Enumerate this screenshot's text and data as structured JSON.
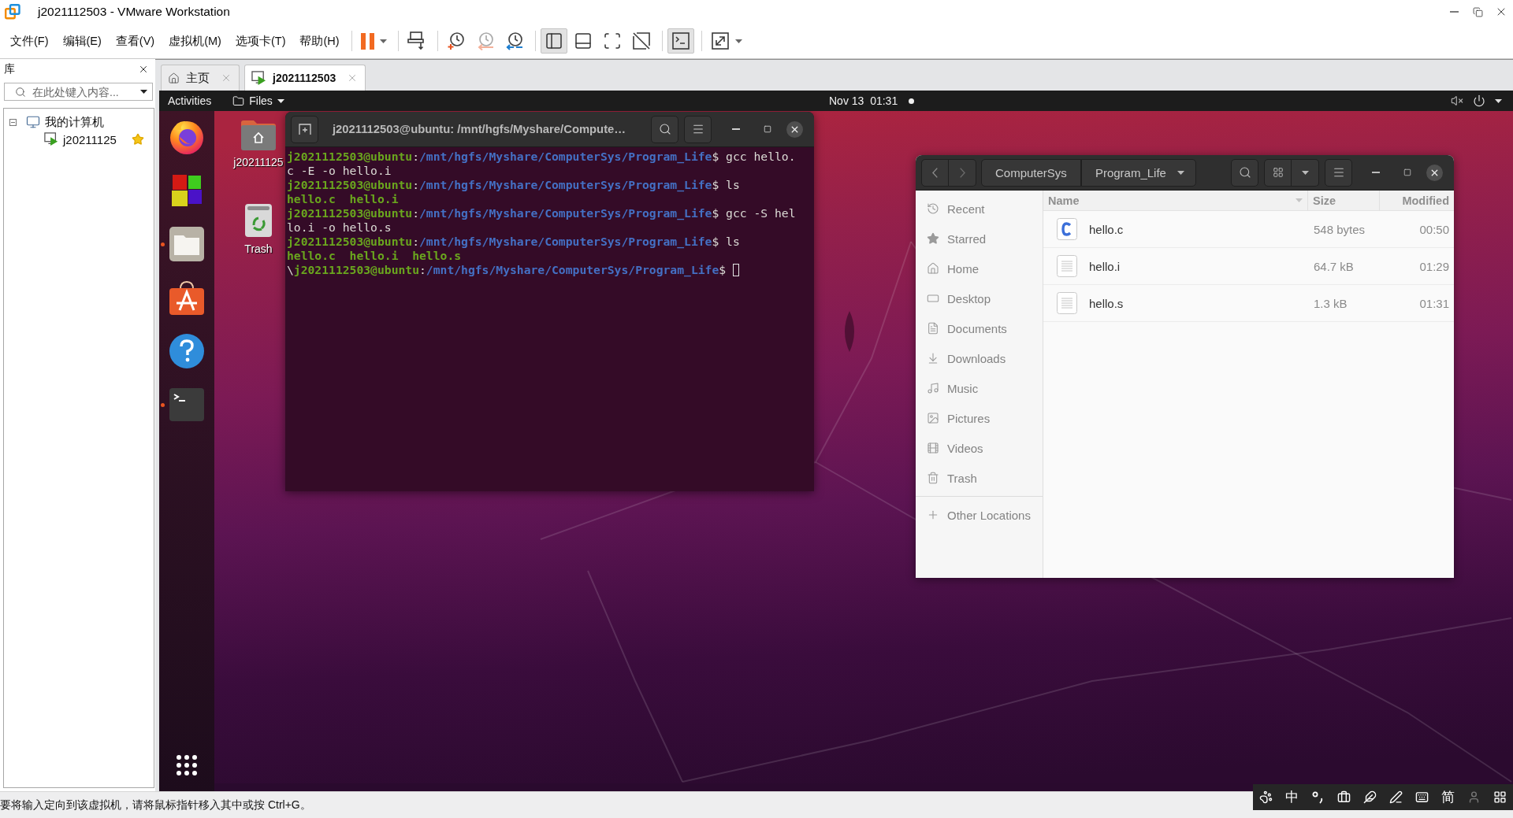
{
  "window": {
    "title": "j2021112503 - VMware Workstation"
  },
  "menu": [
    "文件(F)",
    "编辑(E)",
    "查看(V)",
    "虚拟机(M)",
    "选项卡(T)",
    "帮助(H)"
  ],
  "toolbar": [
    [
      {
        "kind": "pause",
        "dropdown": true,
        "selected": false,
        "disabled": false
      }
    ],
    [
      {
        "kind": "send_keys",
        "dropdown": false,
        "selected": false,
        "disabled": false
      }
    ],
    [
      {
        "kind": "snapshot",
        "dropdown": false,
        "selected": false,
        "disabled": false
      },
      {
        "kind": "revert",
        "dropdown": false,
        "selected": false,
        "disabled": true
      },
      {
        "kind": "snapshot_manager",
        "dropdown": false,
        "selected": false,
        "disabled": false
      }
    ],
    [
      {
        "kind": "library_view",
        "dropdown": false,
        "selected": true,
        "disabled": false
      },
      {
        "kind": "thumbnail_bar",
        "dropdown": false,
        "selected": false,
        "disabled": false
      },
      {
        "kind": "full_screen",
        "dropdown": false,
        "selected": false,
        "disabled": false
      },
      {
        "kind": "unity",
        "dropdown": false,
        "selected": false,
        "disabled": false
      }
    ],
    [
      {
        "kind": "console",
        "dropdown": false,
        "selected": true,
        "disabled": false
      }
    ],
    [
      {
        "kind": "stretch",
        "dropdown": true,
        "selected": false,
        "disabled": false
      }
    ]
  ],
  "library": {
    "title": "库",
    "search_placeholder": "在此处键入内容...",
    "tree": [
      {
        "label": "我的计算机",
        "kind": "computer",
        "expanded": true,
        "selected": false,
        "children": [
          {
            "label": "j20211125",
            "kind": "vm",
            "favorite": true,
            "selected": false
          }
        ]
      }
    ]
  },
  "tabs": [
    {
      "label": "主页",
      "kind": "home",
      "selected": false
    },
    {
      "label": "j2021112503",
      "kind": "vm",
      "selected": true
    }
  ],
  "guest": {
    "top_bar": {
      "activities": "Activities",
      "app_menu": "Files",
      "clock": "Nov 13  01:31",
      "notification": true,
      "muted": true
    },
    "dock": [
      {
        "kind": "firefox",
        "running": false
      },
      {
        "kind": "cubes",
        "running": false
      },
      {
        "kind": "files",
        "running": true
      },
      {
        "kind": "software",
        "running": false
      },
      {
        "kind": "help",
        "running": false
      },
      {
        "kind": "terminal",
        "running": true
      }
    ],
    "desktop_icons": [
      {
        "kind": "home",
        "label": "j20211125"
      },
      {
        "kind": "trash",
        "label": "Trash"
      }
    ],
    "terminal": {
      "title": "j2021112503@ubuntu: /mnt/hgfs/Myshare/Compute…",
      "cursor": true,
      "lines": [
        [
          {
            "kind": "user",
            "text": "j2021112503@ubuntu"
          },
          {
            "kind": "plain",
            "text": ":"
          },
          {
            "kind": "path",
            "text": "/mnt/hgfs/Myshare/ComputerSys/Program_Life"
          },
          {
            "kind": "plain",
            "text": "$ gcc hello."
          }
        ],
        [
          {
            "kind": "plain",
            "text": "c -E -o hello.i"
          }
        ],
        [
          {
            "kind": "user",
            "text": "j2021112503@ubuntu"
          },
          {
            "kind": "plain",
            "text": ":"
          },
          {
            "kind": "path",
            "text": "/mnt/hgfs/Myshare/ComputerSys/Program_Life"
          },
          {
            "kind": "plain",
            "text": "$ ls"
          }
        ],
        [
          {
            "kind": "exec",
            "text": "hello.c  hello.i"
          }
        ],
        [
          {
            "kind": "user",
            "text": "j2021112503@ubuntu"
          },
          {
            "kind": "plain",
            "text": ":"
          },
          {
            "kind": "path",
            "text": "/mnt/hgfs/Myshare/ComputerSys/Program_Life"
          },
          {
            "kind": "plain",
            "text": "$ gcc -S hel"
          }
        ],
        [
          {
            "kind": "plain",
            "text": "lo.i -o hello.s"
          }
        ],
        [
          {
            "kind": "user",
            "text": "j2021112503@ubuntu"
          },
          {
            "kind": "plain",
            "text": ":"
          },
          {
            "kind": "path",
            "text": "/mnt/hgfs/Myshare/ComputerSys/Program_Life"
          },
          {
            "kind": "plain",
            "text": "$ ls"
          }
        ],
        [
          {
            "kind": "exec",
            "text": "hello.c  hello.i  hello.s"
          }
        ],
        [
          {
            "kind": "plain",
            "text": "\\"
          },
          {
            "kind": "user",
            "text": "j2021112503@ubuntu"
          },
          {
            "kind": "plain",
            "text": ":"
          },
          {
            "kind": "path",
            "text": "/mnt/hgfs/Myshare/ComputerSys/Program_Life"
          },
          {
            "kind": "plain",
            "text": "$ "
          }
        ]
      ]
    },
    "files": {
      "path": [
        "ComputerSys",
        "Program_Life"
      ],
      "sidebar": [
        {
          "kind": "recent",
          "label": "Recent",
          "selected": false
        },
        {
          "kind": "starred",
          "label": "Starred",
          "selected": false
        },
        {
          "kind": "home",
          "label": "Home",
          "selected": false
        },
        {
          "kind": "desktop",
          "label": "Desktop",
          "selected": false
        },
        {
          "kind": "documents",
          "label": "Documents",
          "selected": false
        },
        {
          "kind": "downloads",
          "label": "Downloads",
          "selected": false
        },
        {
          "kind": "music",
          "label": "Music",
          "selected": false
        },
        {
          "kind": "pictures",
          "label": "Pictures",
          "selected": false
        },
        {
          "kind": "videos",
          "label": "Videos",
          "selected": false
        },
        {
          "kind": "trash",
          "label": "Trash",
          "selected": false
        },
        {
          "kind": "other",
          "label": "Other Locations",
          "selected": false
        }
      ],
      "columns": [
        {
          "label": "Name",
          "sorted": true
        },
        {
          "label": "Size",
          "sorted": false
        },
        {
          "label": "Modified",
          "sorted": false
        }
      ],
      "rows": [
        {
          "kind": "c_source",
          "name": "hello.c",
          "size": "548 bytes",
          "modified": "00:50",
          "selected": false
        },
        {
          "kind": "text",
          "name": "hello.i",
          "size": "64.7 kB",
          "modified": "01:29",
          "selected": false
        },
        {
          "kind": "text",
          "name": "hello.s",
          "size": "1.3 kB",
          "modified": "01:31",
          "selected": false
        }
      ]
    }
  },
  "status_bar": {
    "text": "要将输入定向到该虚拟机，请将鼠标指针移入其中或按 Ctrl+G。"
  },
  "ime_toolbar": [
    {
      "kind": "paw"
    },
    {
      "kind": "text",
      "text": "中"
    },
    {
      "kind": "punctuation"
    },
    {
      "kind": "toolbox"
    },
    {
      "kind": "feather"
    },
    {
      "kind": "pen"
    },
    {
      "kind": "keyboard"
    },
    {
      "kind": "text",
      "text": "简"
    },
    {
      "kind": "user"
    },
    {
      "kind": "grid"
    }
  ]
}
